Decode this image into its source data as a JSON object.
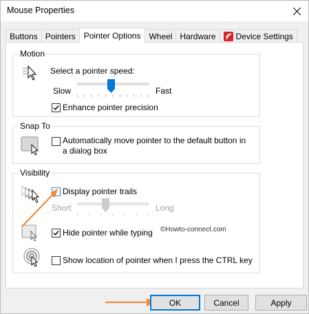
{
  "window": {
    "title": "Mouse Properties"
  },
  "tabs": [
    {
      "label": "Buttons"
    },
    {
      "label": "Pointers"
    },
    {
      "label": "Pointer Options"
    },
    {
      "label": "Wheel"
    },
    {
      "label": "Hardware"
    },
    {
      "label": "Device Settings"
    }
  ],
  "motion": {
    "title": "Motion",
    "speed_label": "Select a pointer speed:",
    "slow": "Slow",
    "fast": "Fast",
    "speed_level": 0.48,
    "enhance_label": "Enhance pointer precision",
    "enhance_checked": true
  },
  "snap_to": {
    "title": "Snap To",
    "label": "Automatically move pointer to the default button in a dialog box",
    "checked": false
  },
  "visibility": {
    "title": "Visibility",
    "trails_label": "Display pointer trails",
    "trails_checked": false,
    "short": "Short",
    "long": "Long",
    "trails_level": 0.4,
    "hide_label": "Hide pointer while typing",
    "hide_checked": true,
    "show_location_label": "Show location of pointer when I press the CTRL key",
    "show_location_checked": false
  },
  "watermark": "©Howto-connect.com",
  "buttons": {
    "ok": "OK",
    "cancel": "Cancel",
    "apply": "Apply"
  },
  "colors": {
    "accent": "#0078d7",
    "annotation_arrow": "#f28a3c",
    "slider_thumb": "#0078d7"
  }
}
